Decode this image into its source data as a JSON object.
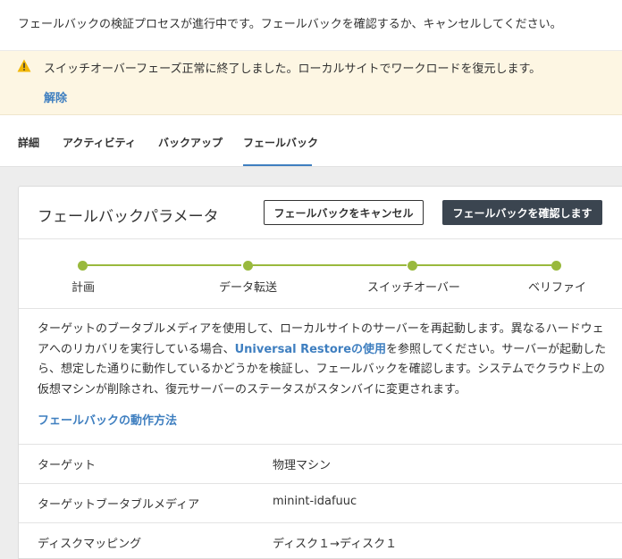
{
  "header": {
    "message": "フェールバックの検証プロセスが進行中です。フェールバックを確認するか、キャンセルしてください。"
  },
  "warning": {
    "text": "スイッチオーバーフェーズ正常に終了しました。ローカルサイトでワークロードを復元します。",
    "dismiss_label": "解除",
    "icon": "warning-icon",
    "icon_color": "#f2b705"
  },
  "tabs": [
    {
      "label": "詳細"
    },
    {
      "label": "アクティビティ"
    },
    {
      "label": "バックアップ"
    },
    {
      "label": "フェールバック",
      "active": true
    }
  ],
  "card": {
    "title": "フェールバックパラメータ",
    "cancel_label": "フェールバックをキャンセル",
    "confirm_label": "フェールバックを確認します"
  },
  "steps": [
    {
      "label": "計画"
    },
    {
      "label": "データ転送"
    },
    {
      "label": "スイッチオーバー"
    },
    {
      "label": "ベリファイ"
    }
  ],
  "description": {
    "part1": "ターゲットのブータブルメディアを使用して、ローカルサイトのサーバーを再起動します。異なるハードウェアへのリカバリを実行している場合、",
    "link": "Universal Restoreの使用",
    "part2": "を参照してください。サーバーが起動したら、想定した通りに動作しているかどうかを検証し、フェールバックを確認します。システムでクラウド上の仮想マシンが削除され、復元サーバーのステータスがスタンバイに変更されます。"
  },
  "how_link": "フェールバックの動作方法",
  "rows": [
    {
      "label": "ターゲット",
      "value": "物理マシン"
    },
    {
      "label": "ターゲットブータブルメディア",
      "value": "minint-idafuuc"
    },
    {
      "label": "ディスクマッピング",
      "value": "ディスク１→ディスク１"
    }
  ],
  "colors": {
    "accent": "#3f7fc0",
    "step": "#99b93d",
    "confirm_button": "#3b4550",
    "warning_bg": "#fdf6e3"
  }
}
